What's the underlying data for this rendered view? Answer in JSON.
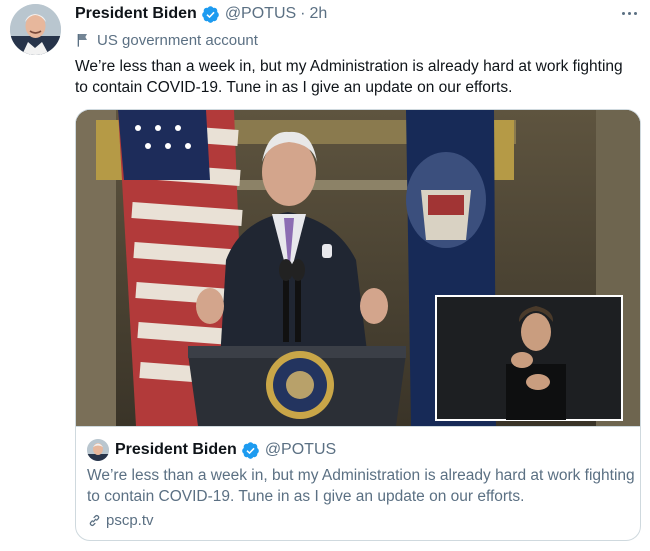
{
  "tweet": {
    "display_name": "President Biden",
    "handle": "@POTUS",
    "separator": "·",
    "time": "2h",
    "label": "US government account",
    "text": "We’re less than a week in, but my Administration is already hard at work fighting to contain COVID-19. Tune in as I give an update on our efforts."
  },
  "card": {
    "display_name": "President Biden",
    "handle": "@POTUS",
    "text": "We’re less than a week in, but my Administration is already hard at work fighting to contain COVID-19. Tune in as I give an update on our efforts.",
    "link": "pscp.tv"
  },
  "icons": {
    "verified": "verified-badge-icon",
    "label": "flag-icon",
    "more": "more-options-icon",
    "link": "link-icon"
  },
  "colors": {
    "verified_blue": "#1d9bf0",
    "secondary_text": "#5b7083",
    "border": "#cfd9de"
  }
}
